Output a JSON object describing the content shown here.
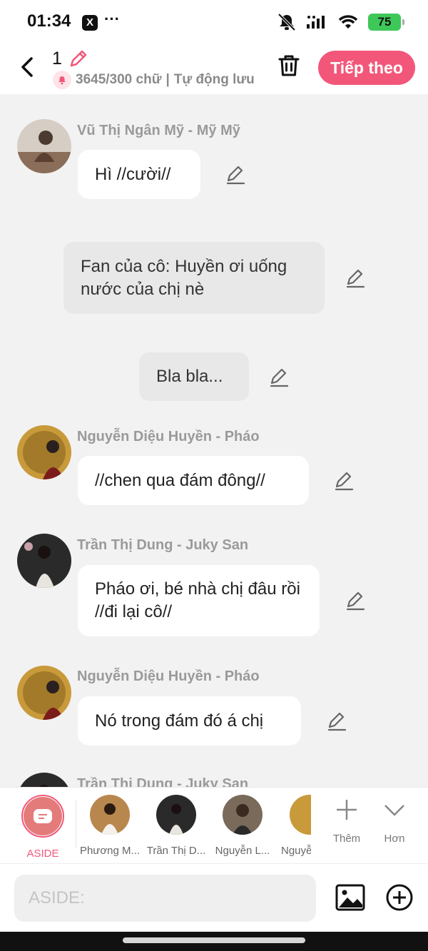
{
  "status_bar": {
    "time": "01:34",
    "app_badge": "X",
    "more": "···",
    "battery": "75",
    "icons": [
      "mute-icon",
      "signal-icon",
      "wifi-icon",
      "battery-icon"
    ]
  },
  "header": {
    "title": "1",
    "word_count": "3645/300 chữ",
    "separator": "|",
    "autosave": "Tự động lưu",
    "next_button": "Tiếp theo"
  },
  "messages": [
    {
      "speaker": "Vũ Thị Ngân Mỹ - Mỹ Mỹ",
      "text": "Hì //cười//"
    },
    {
      "text": "Fan của cô: Huyền ơi uống nước của chị nè"
    },
    {
      "text": "Bla bla..."
    },
    {
      "speaker": "Nguyễn Diệu Huyền - Pháo",
      "text": "//chen qua đám đông//"
    },
    {
      "speaker": "Trần Thị Dung - Juky San",
      "text": "Pháo ơi, bé nhà chị đâu rồi //đi lại cô//"
    },
    {
      "speaker": "Nguyễn Diệu Huyền - Pháo",
      "text": "Nó trong đám đó á chị"
    },
    {
      "speaker": "Trần Thị Dung - Juky San"
    }
  ],
  "roles": [
    {
      "label": "ASIDE"
    },
    {
      "label": "Phương M..."
    },
    {
      "label": "Trần Thị D..."
    },
    {
      "label": "Nguyễn L..."
    },
    {
      "label": "Nguyễ"
    }
  ],
  "actions": {
    "add": "Thêm",
    "more": "Hơn"
  },
  "input": {
    "placeholder": "ASIDE:"
  },
  "colors": {
    "accent": "#f2577a",
    "background": "#f2f2f2",
    "bubble": "#ffffff",
    "narration_bubble": "#e8e8e8"
  }
}
